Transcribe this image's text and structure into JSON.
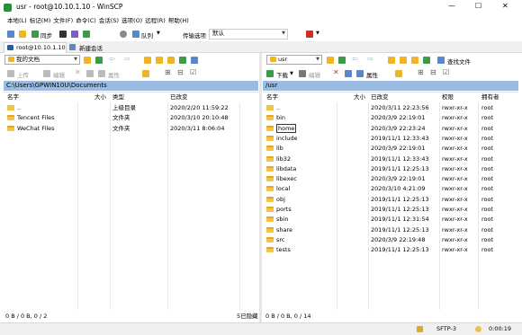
{
  "window": {
    "title": "usr - root@10.10.1.10 - WinSCP",
    "controls": [
      "—",
      "☐",
      "✕"
    ]
  },
  "menu": [
    "本地(L)",
    "标记(M)",
    "文件(F)",
    "命令(C)",
    "会话(S)",
    "选项(O)",
    "远程(R)",
    "帮助(H)"
  ],
  "toolbar": {
    "sync_label": "同步",
    "queue_label": "队列",
    "transfer_label": "传输选项",
    "transfer_value": "默认"
  },
  "tabs": {
    "session_label": "root@10.10.1.10",
    "new_session_label": "新建会话"
  },
  "left_panel": {
    "location": "我的文档",
    "upload_label": "上传",
    "edit_label": "编辑",
    "props_label": "属性",
    "path": "C:\\Users\\GPWIN10U\\Documents",
    "headers": {
      "name": "名字",
      "size": "大小",
      "type": "类型",
      "modified": "已改变"
    },
    "rows": [
      {
        "name": "..",
        "size": "",
        "type": "上级目录",
        "modified": "2020/2/20  11:59:22",
        "icon": "parent-folder-icon"
      },
      {
        "name": "Tencent Files",
        "size": "",
        "type": "文件夹",
        "modified": "2020/3/10  20:10:48",
        "icon": "folder-icon"
      },
      {
        "name": "WeChat Files",
        "size": "",
        "type": "文件夹",
        "modified": "2020/3/11  8:06:04",
        "icon": "folder-icon"
      }
    ],
    "status_left": "0 B / 0 B,  0 / 2",
    "status_right": "5已隐藏"
  },
  "right_panel": {
    "location": "usr",
    "download_label": "下载",
    "edit_label": "编辑",
    "props_label": "属性",
    "find_label": "查找文件",
    "path": "/usr",
    "headers": {
      "name": "名字",
      "size": "大小",
      "modified": "已改变",
      "perms": "权限",
      "owner": "拥有者"
    },
    "rows": [
      {
        "name": "..",
        "modified": "2020/3/11 22:23:56",
        "perms": "rwxr-xr-x",
        "owner": "root",
        "icon": "parent-folder-icon"
      },
      {
        "name": "bin",
        "modified": "2020/3/9 22:19:01",
        "perms": "rwxr-xr-x",
        "owner": "root",
        "icon": "folder-icon"
      },
      {
        "name": "home",
        "modified": "2020/3/9 22:23:24",
        "perms": "rwxr-xr-x",
        "owner": "root",
        "icon": "folder-icon"
      },
      {
        "name": "include",
        "modified": "2019/11/1 12:33:43",
        "perms": "rwxr-xr-x",
        "owner": "root",
        "icon": "folder-icon"
      },
      {
        "name": "lib",
        "modified": "2020/3/9 22:19:01",
        "perms": "rwxr-xr-x",
        "owner": "root",
        "icon": "folder-icon"
      },
      {
        "name": "lib32",
        "modified": "2019/11/1 12:33:43",
        "perms": "rwxr-xr-x",
        "owner": "root",
        "icon": "folder-icon"
      },
      {
        "name": "libdata",
        "modified": "2019/11/1 12:25:13",
        "perms": "rwxr-xr-x",
        "owner": "root",
        "icon": "folder-icon"
      },
      {
        "name": "libexec",
        "modified": "2020/3/9 22:19:01",
        "perms": "rwxr-xr-x",
        "owner": "root",
        "icon": "folder-icon"
      },
      {
        "name": "local",
        "modified": "2020/3/10 4:21:09",
        "perms": "rwxr-xr-x",
        "owner": "root",
        "icon": "folder-icon"
      },
      {
        "name": "obj",
        "modified": "2019/11/1 12:25:13",
        "perms": "rwxr-xr-x",
        "owner": "root",
        "icon": "folder-icon"
      },
      {
        "name": "ports",
        "modified": "2019/11/1 12:25:13",
        "perms": "rwxr-xr-x",
        "owner": "root",
        "icon": "folder-icon"
      },
      {
        "name": "sbin",
        "modified": "2019/11/1 12:31:54",
        "perms": "rwxr-xr-x",
        "owner": "root",
        "icon": "folder-icon"
      },
      {
        "name": "share",
        "modified": "2019/11/1 12:25:13",
        "perms": "rwxr-xr-x",
        "owner": "root",
        "icon": "folder-icon"
      },
      {
        "name": "src",
        "modified": "2020/3/9 22:19:48",
        "perms": "rwxr-xr-x",
        "owner": "root",
        "icon": "folder-icon"
      },
      {
        "name": "tests",
        "modified": "2019/11/1 12:25:13",
        "perms": "rwxr-xr-x",
        "owner": "root",
        "icon": "folder-icon"
      }
    ],
    "status_left": "0 B / 0 B,  0 / 14"
  },
  "statusbar": {
    "protocol": "SFTP-3",
    "elapsed": "0:00:19"
  },
  "colors": {
    "path_bg": "#9bbbe3",
    "accent": "#0078d7",
    "folder": "#f4c542"
  }
}
